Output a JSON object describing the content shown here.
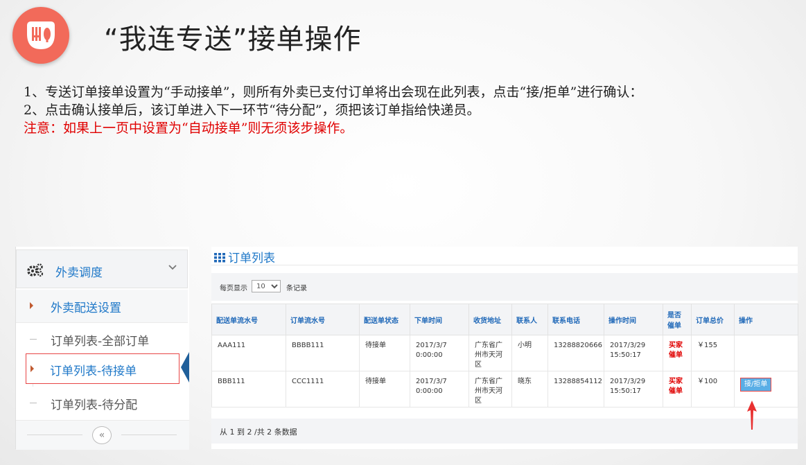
{
  "header": {
    "title": "“我连专送”接单操作"
  },
  "instructions": {
    "line1": "1、专送订单接单设置为“手动接单”，则所有外卖已支付订单将出会现在此列表，点击“接/拒单”进行确认：",
    "line2": "2、点击确认接单后，该订单进入下一环节“待分配”，须把该订单指给快递员。",
    "note": "注意：如果上一页中设置为“自动接单”则无须该步操作。"
  },
  "sidebar": {
    "group_label": "外卖调度",
    "items": [
      {
        "label": "外卖配送设置"
      },
      {
        "label": "订单列表-全部订单"
      },
      {
        "label": "订单列表-待接单"
      },
      {
        "label": "订单列表-待分配"
      }
    ],
    "collapse_symbol": "«"
  },
  "panel": {
    "title": "订单列表",
    "page_size_prefix": "每页显示",
    "page_size_value": "10",
    "page_size_suffix": "条记录",
    "footer": "从 1 到 2 /共 2 条数据"
  },
  "table": {
    "columns": [
      "配送单流水号",
      "订单流水号",
      "配送单状态",
      "下单时间",
      "收货地址",
      "联系人",
      "联系电话",
      "操作时间",
      "是否催单",
      "订单总价",
      "操作"
    ],
    "rows": [
      {
        "delivery_no": "AAA111",
        "order_no": "BBBB111",
        "status": "待接单",
        "order_time": "2017/3/7 0:00:00",
        "address": "广东省广州市天河区",
        "contact": "小明",
        "phone": "13288820666",
        "op_time": "2017/3/29 15:50:17",
        "urge": "买家催单",
        "total": "￥155",
        "action": ""
      },
      {
        "delivery_no": "BBB111",
        "order_no": "CCC1111",
        "status": "待接单",
        "order_time": "2017/3/7 0:00:00",
        "address": "广东省广州市天河区",
        "contact": "晓东",
        "phone": "13288854112",
        "op_time": "2017/3/29 15:50:17",
        "urge": "买家催单",
        "total": "￥100",
        "action": "接/拒单"
      }
    ]
  },
  "colors": {
    "logo_bg": "#f26a5a",
    "link_blue": "#1f78c8",
    "alert_red": "#e00000",
    "button_blue": "#5aaee6"
  },
  "icons": [
    "restaurant-logo-icon",
    "gears-icon",
    "chevron-down-icon",
    "grid-icon",
    "caret-right-icon",
    "double-chevron-left-icon",
    "red-up-arrow-icon"
  ]
}
